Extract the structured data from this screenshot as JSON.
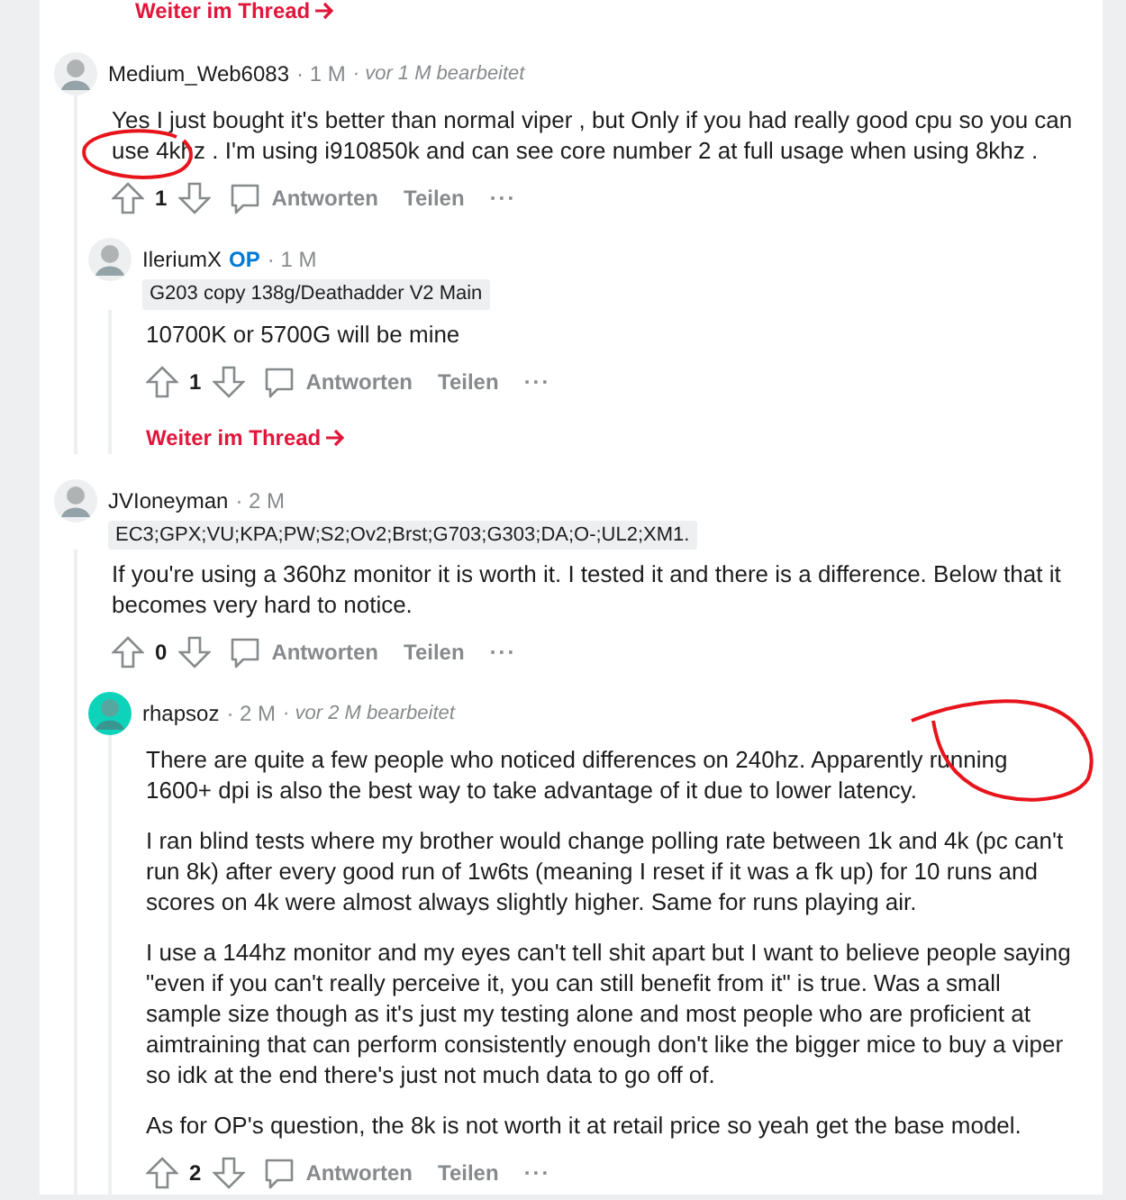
{
  "continue_above": {
    "label": "Weiter im Thread"
  },
  "comments": [
    {
      "author": "Medium_Web6083",
      "time": "· 1 M",
      "edited": "· vor 1 M bearbeitet",
      "color": "#edeff1",
      "paragraphs": [
        "Yes I just bought it's better than normal viper , but Only if you had really good cpu so you can use 4khz . I'm using i910850k and can see core number 2 at full usage when using 8khz ."
      ],
      "votes": "1",
      "reply": "Antworten",
      "share": "Teilen",
      "more": "···",
      "replies": [
        {
          "author": "IleriumX",
          "op_label": "OP",
          "flair": "G203 copy 138g/Deathadder V2 Main",
          "time": "· 1 M",
          "color": "#edeff1",
          "paragraphs": [
            "10700K or 5700G will be mine"
          ],
          "votes": "1",
          "reply": "Antworten",
          "share": "Teilen",
          "more": "···",
          "continue": "Weiter im Thread"
        }
      ]
    },
    {
      "author": "JVIoneyman",
      "flair": "EC3;GPX;VU;KPA;PW;S2;Ov2;Brst;G703;G303;DA;O-;UL2;XM1.",
      "time": "· 2 M",
      "color": "#edeff1",
      "paragraphs": [
        "If you're using a 360hz monitor it is worth it. I tested it and there is a difference. Below that it becomes very hard to notice."
      ],
      "votes": "0",
      "reply": "Antworten",
      "share": "Teilen",
      "more": "···",
      "replies": [
        {
          "author": "rhapsoz",
          "time": "· 2 M",
          "edited": "· vor 2 M bearbeitet",
          "color": "#0dd3bb",
          "paragraphs": [
            "There are quite a few people who noticed differences on 240hz. Apparently running 1600+ dpi is also the best way to take advantage of it due to lower latency.",
            "I ran blind tests where my brother would change polling rate between 1k and 4k (pc can't run 8k) after every good run of 1w6ts (meaning I reset if it was a fk up) for 10 runs and scores on 4k were almost always slightly higher. Same for runs playing air.",
            "I use a 144hz monitor and my eyes can't tell shit apart but I want to believe people saying \"even if you can't really perceive it, you can still benefit from it\" is true. Was a small sample size though as it's just my testing alone and most people who are proficient at aimtraining that can perform consistently enough don't like the bigger mice to buy a viper so idk at the end there's just not much data to go off of.",
            "As for OP's question, the 8k is not worth it at retail price so yeah get the base model."
          ],
          "votes": "2",
          "reply": "Antworten",
          "share": "Teilen",
          "more": "···"
        }
      ]
    }
  ]
}
